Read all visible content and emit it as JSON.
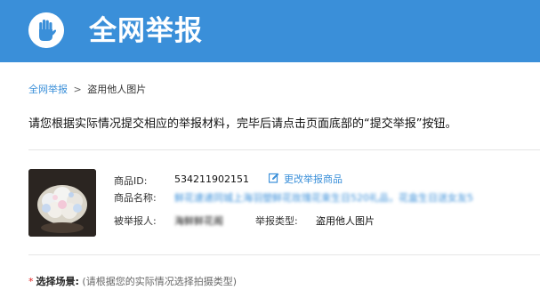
{
  "header": {
    "title": "全网举报",
    "logo_icon": "raised-hand-icon",
    "background_color": "#3a8fd9"
  },
  "breadcrumb": {
    "root": "全网举报",
    "separator": ">",
    "current": "盗用他人图片"
  },
  "instructions": "请您根据实际情况提交相应的举报材料，完毕后请点击页面底部的“提交举报”按钮。",
  "product": {
    "id_label": "商品ID:",
    "id_value": "534211902151",
    "edit_label": "更改举报商品",
    "edit_icon": "edit-icon",
    "name_label": "商品名称:",
    "name_value": "鲜花速递同城上海羽塑鲜花玫瑰花束生日520礼品，花盒生日送女友5",
    "reported_label": "被举报人:",
    "reported_value": "海鲜鲜花阁",
    "type_label": "举报类型:",
    "type_value": "盗用他人图片"
  },
  "scene": {
    "required_marker": "*",
    "label": "选择场景:",
    "hint": "(请根据您的实际情况选择拍摄类型)"
  }
}
